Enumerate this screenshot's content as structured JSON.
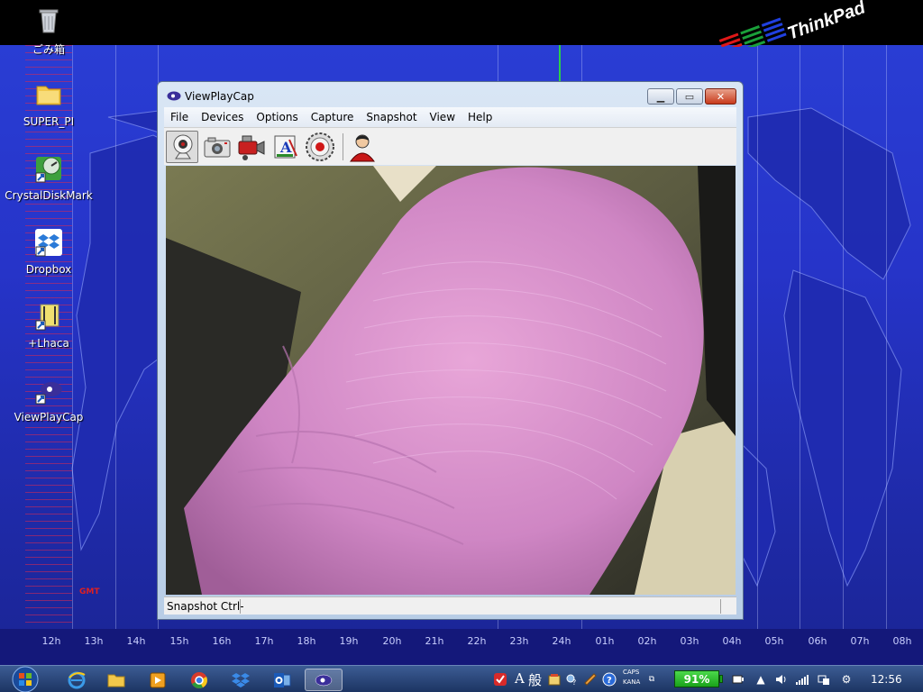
{
  "desktop": {
    "hours": [
      "12h",
      "13h",
      "14h",
      "15h",
      "16h",
      "17h",
      "18h",
      "19h",
      "20h",
      "21h",
      "22h",
      "23h",
      "24h",
      "01h",
      "02h",
      "03h",
      "04h",
      "05h",
      "06h",
      "07h",
      "08h"
    ],
    "gmt_label": "GMT",
    "logo_text": "ThinkPad",
    "icons": [
      {
        "label": "ごみ箱",
        "icon": "recycle-bin-icon"
      },
      {
        "label": "SUPER_PI",
        "icon": "folder-icon"
      },
      {
        "label": "CrystalDiskMark",
        "icon": "crystaldiskmark-icon"
      },
      {
        "label": "Dropbox",
        "icon": "dropbox-icon"
      },
      {
        "label": "+Lhaca",
        "icon": "lhaca-icon"
      },
      {
        "label": "ViewPlayCap",
        "icon": "viewplaycap-icon"
      }
    ]
  },
  "window": {
    "title": "ViewPlayCap",
    "controls": {
      "minimize": "minimize-icon",
      "maximize": "maximize-icon",
      "close": "close-icon"
    },
    "menu": [
      "File",
      "Devices",
      "Options",
      "Capture",
      "Snapshot",
      "View",
      "Help"
    ],
    "toolbar": [
      "webcam-icon",
      "camera-icon",
      "video-camera-icon",
      "image-settings-icon",
      "record-icon",
      "person-icon"
    ],
    "status": "Snapshot Ctrl-"
  },
  "taskbar": {
    "apps": [
      "internet-explorer-icon",
      "explorer-folder-icon",
      "media-player-icon",
      "chrome-icon",
      "dropbox-icon",
      "outlook-icon",
      "viewplaycap-icon"
    ],
    "ime": {
      "mode": "A",
      "han": "般",
      "caps": "CAPS",
      "kana": "KANA"
    },
    "battery": "91%",
    "clock": "12:56"
  },
  "colors": {
    "wallpaper": "#2634c9",
    "taskbar": "#1c3462",
    "battery": "#1aa21a",
    "close_button": "#c83a1c"
  }
}
